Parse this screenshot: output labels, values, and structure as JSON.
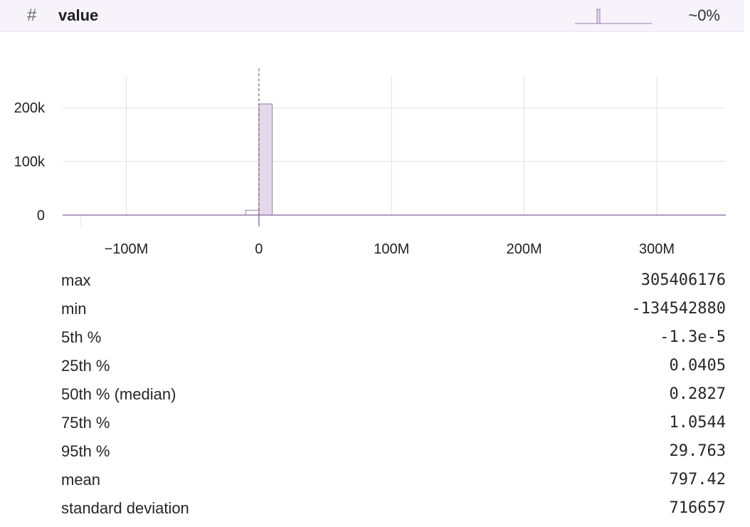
{
  "column": {
    "type_icon": "#",
    "name": "value",
    "missing_pct": "~0%"
  },
  "colors": {
    "bar_fill": "#e6d8ec",
    "bar_stroke": "#9a7aaa",
    "grid": "#e2e2e2",
    "header_bg": "#f6f4fa"
  },
  "chart_data": {
    "type": "bar",
    "bins": [
      {
        "x0": -10000000,
        "x1": 0,
        "count": 9000
      },
      {
        "x0": 0,
        "x1": 10000000,
        "count": 207000
      }
    ],
    "x_ticks": [
      {
        "value": -100000000,
        "label": "−100M"
      },
      {
        "value": 0,
        "label": "0"
      },
      {
        "value": 100000000,
        "label": "100M"
      },
      {
        "value": 200000000,
        "label": "200M"
      },
      {
        "value": 300000000,
        "label": "300M"
      }
    ],
    "y_ticks": [
      {
        "value": 0,
        "label": "0"
      },
      {
        "value": 100000,
        "label": "100k"
      },
      {
        "value": 200000,
        "label": "200k"
      }
    ],
    "xlim": [
      -148000000,
      352000000
    ],
    "ylim": [
      0,
      260000
    ],
    "zero_rule": true,
    "grid": true
  },
  "stats": [
    {
      "label": "max",
      "value": "305406176"
    },
    {
      "label": "min",
      "value": "-134542880"
    },
    {
      "label": "5th %",
      "value": "-1.3e-5"
    },
    {
      "label": "25th %",
      "value": "0.0405"
    },
    {
      "label": "50th % (median)",
      "value": "0.2827"
    },
    {
      "label": "75th %",
      "value": "1.0544"
    },
    {
      "label": "95th %",
      "value": "29.763"
    },
    {
      "label": "mean",
      "value": "797.42"
    },
    {
      "label": "standard deviation",
      "value": "716657"
    }
  ]
}
